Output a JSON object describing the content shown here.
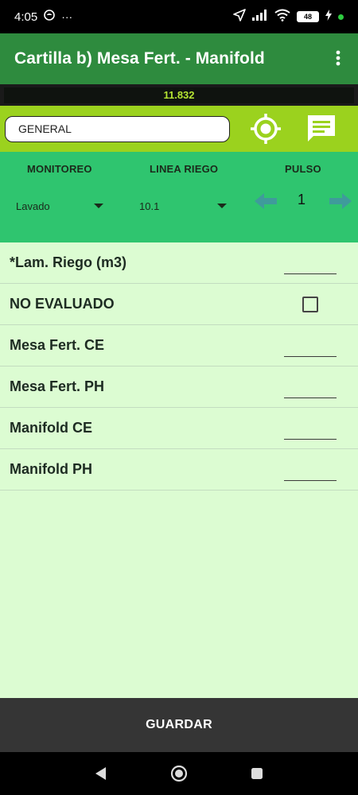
{
  "status_bar": {
    "time": "4:05",
    "more": "···",
    "battery": "48"
  },
  "app_bar": {
    "title": "Cartilla b) Mesa Fert. - Manifold",
    "menu_icon": "more-vert-icon"
  },
  "value_strip": {
    "value": "11.832"
  },
  "toolbar": {
    "general_value": "GENERAL",
    "location_icon": "gps-target-icon",
    "notes_icon": "chat-notes-icon"
  },
  "filters": {
    "monitoreo_label": "MONITOREO",
    "linea_riego_label": "LINEA RIEGO",
    "pulso_label": "PULSO",
    "monitoreo_value": "Lavado",
    "linea_riego_value": "10.1",
    "pulso_value": "1"
  },
  "form": {
    "rows": [
      {
        "label": "*Lam. Riego (m3)",
        "type": "input",
        "value": ""
      },
      {
        "label": "NO EVALUADO",
        "type": "checkbox",
        "checked": false
      },
      {
        "label": "Mesa Fert. CE",
        "type": "input",
        "value": ""
      },
      {
        "label": "Mesa Fert. PH",
        "type": "input",
        "value": ""
      },
      {
        "label": "Manifold CE",
        "type": "input",
        "value": ""
      },
      {
        "label": "Manifold PH",
        "type": "input",
        "value": ""
      }
    ]
  },
  "save_button": {
    "label": "GUARDAR"
  },
  "colors": {
    "app_bar": "#2e8b3e",
    "toolbar": "#9bd21e",
    "filter_panel": "#2fc56f",
    "form_bg": "#dcfcd2",
    "save_bar": "#353535",
    "value_text": "#b6e533"
  }
}
